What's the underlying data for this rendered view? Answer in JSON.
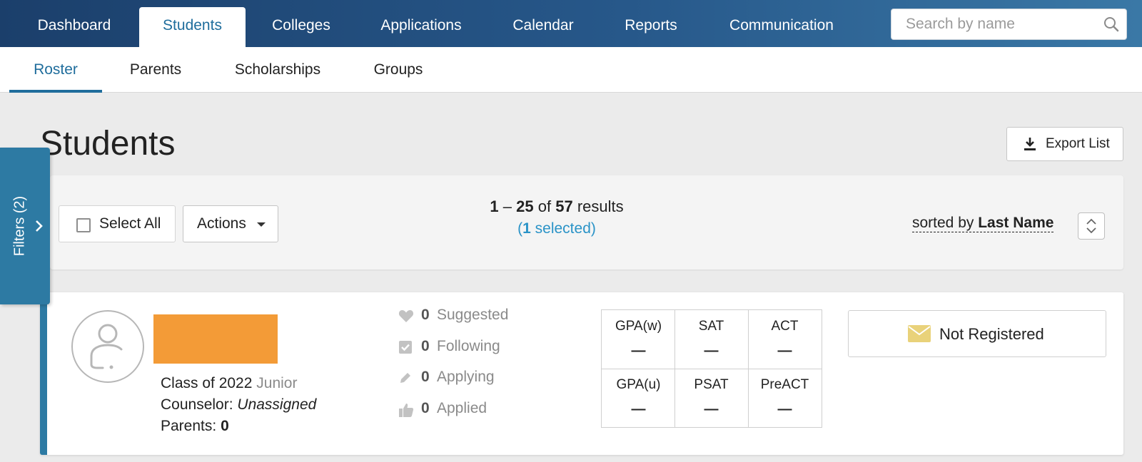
{
  "topnav": {
    "tabs": [
      {
        "label": "Dashboard"
      },
      {
        "label": "Students"
      },
      {
        "label": "Colleges"
      },
      {
        "label": "Applications"
      },
      {
        "label": "Calendar"
      },
      {
        "label": "Reports"
      },
      {
        "label": "Communication"
      }
    ],
    "active_tab": "Students",
    "search_placeholder": "Search by name",
    "search_icon": "magnifier-icon"
  },
  "subnav": {
    "tabs": [
      {
        "label": "Roster"
      },
      {
        "label": "Parents"
      },
      {
        "label": "Scholarships"
      },
      {
        "label": "Groups"
      }
    ],
    "active_tab": "Roster"
  },
  "page": {
    "title": "Students",
    "export_label": "Export List"
  },
  "filters": {
    "label": "Filters (2)"
  },
  "toolbar": {
    "select_all_label": "Select All",
    "actions_label": "Actions",
    "range_start": "1",
    "range_sep": "–",
    "range_end": "25",
    "of_word": "of",
    "total": "57",
    "results_word": "results",
    "selected_open": "(",
    "selected_count": "1",
    "selected_word": "selected)",
    "sorted_prefix": "sorted by",
    "sorted_field": "Last Name"
  },
  "student": {
    "class_of": "Class of 2022",
    "grade": "Junior",
    "counselor_label": "Counselor:",
    "counselor_value": "Unassigned",
    "parents_label": "Parents:",
    "parents_value": "0",
    "stats": [
      {
        "icon": "heart-icon",
        "count": "0",
        "label": "Suggested"
      },
      {
        "icon": "checkbox-icon",
        "count": "0",
        "label": "Following"
      },
      {
        "icon": "pencil-icon",
        "count": "0",
        "label": "Applying"
      },
      {
        "icon": "thumbs-up-icon",
        "count": "0",
        "label": "Applied"
      }
    ],
    "scores": [
      {
        "label": "GPA(w)",
        "value": "—"
      },
      {
        "label": "SAT",
        "value": "—"
      },
      {
        "label": "ACT",
        "value": "—"
      },
      {
        "label": "GPA(u)",
        "value": "—"
      },
      {
        "label": "PSAT",
        "value": "—"
      },
      {
        "label": "PreACT",
        "value": "—"
      }
    ],
    "registration_status": "Not Registered"
  },
  "colors": {
    "nav_dark": "#1b3f6b",
    "accent": "#1f6d9c",
    "link": "#2a93c7",
    "redaction": "#f39b37",
    "envelope": "#e9d27a"
  }
}
